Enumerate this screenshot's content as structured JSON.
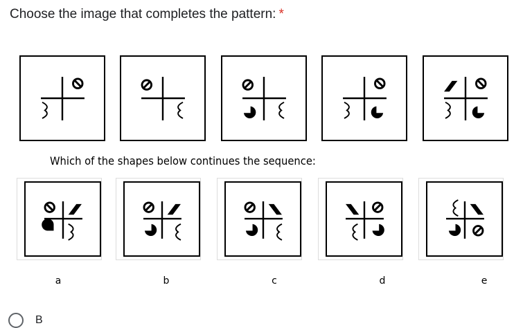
{
  "question": {
    "text": "Choose the image that completes the pattern:",
    "required_marker": "*"
  },
  "subtitle": "Which of the shapes below continues the sequence:",
  "options": [
    {
      "label": "a"
    },
    {
      "label": "b"
    },
    {
      "label": "c"
    },
    {
      "label": "d"
    },
    {
      "label": "e"
    }
  ],
  "answer_choices": [
    {
      "label": "B",
      "selected": false
    }
  ]
}
